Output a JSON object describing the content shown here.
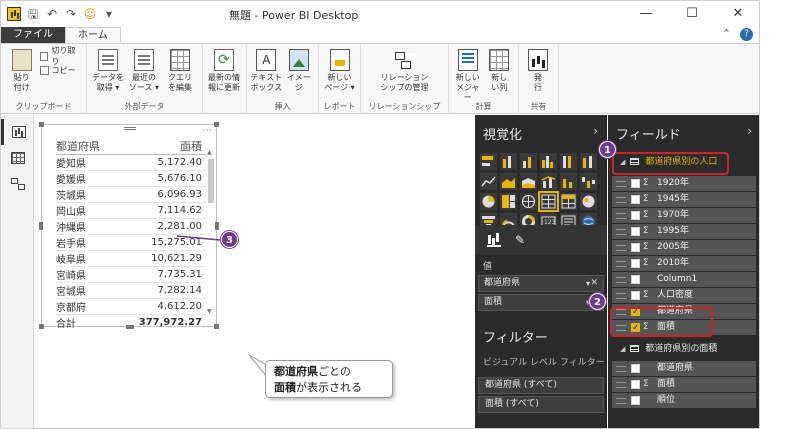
{
  "window": {
    "title": "無題 - Power BI Desktop",
    "controls": {
      "minimize": "—",
      "maximize": "☐",
      "close": "✕"
    }
  },
  "qat": {
    "save": "🖫",
    "undo": "↶",
    "redo": "↷",
    "smile": "☺",
    "more": "▾"
  },
  "tabs": [
    {
      "label": "ファイル"
    },
    {
      "label": "ホーム"
    }
  ],
  "help": "?",
  "collapse": "⌃",
  "ribbon": {
    "groups": [
      {
        "label": "クリップボード",
        "paste": "貼り\n付け",
        "cut": "切り取り",
        "copy": "コピー"
      },
      {
        "label": "外部データ",
        "buttons": [
          "データを\n取得 ▾",
          "最近の\nソース ▾",
          "クエリ\nを編集"
        ]
      },
      {
        "label": "",
        "buttons": [
          "最新の情\n報に更新"
        ]
      },
      {
        "label": "挿入",
        "buttons": [
          "テキスト\nボックス",
          "イメー\nジ"
        ]
      },
      {
        "label": "レポート",
        "buttons": [
          "新しい\nページ ▾"
        ]
      },
      {
        "label": "リレーションシップ",
        "buttons": [
          "リレーション\nシップの管理"
        ]
      },
      {
        "label": "計算",
        "buttons": [
          "新しい\nメジャー",
          "新し\nい列"
        ]
      },
      {
        "label": "共有",
        "buttons": [
          "発\n行"
        ]
      }
    ]
  },
  "table": {
    "headers": [
      "都道府県",
      "面積"
    ],
    "rows": [
      [
        "愛知県",
        "5,172.40"
      ],
      [
        "愛媛県",
        "5,676.10"
      ],
      [
        "茨城県",
        "6,096.93"
      ],
      [
        "岡山県",
        "7,114.62"
      ],
      [
        "沖縄県",
        "2,281.00"
      ],
      [
        "岩手県",
        "15,275.01"
      ],
      [
        "岐阜県",
        "10,621.29"
      ],
      [
        "宮崎県",
        "7,735.31"
      ],
      [
        "宮城県",
        "7,282.14"
      ],
      [
        "京都府",
        "4,612.20"
      ]
    ],
    "total": [
      "合計",
      "377,972.27"
    ],
    "more": "···"
  },
  "callout": {
    "badges": [
      "1",
      "2",
      "3"
    ],
    "line1_bold": "都道府県",
    "line1_rest": "ごとの",
    "line2_bold": "面積",
    "line2_rest": "が表示される"
  },
  "viz_pane": {
    "title": "視覚化",
    "chevron": "›",
    "values_label": "値",
    "wells": [
      "都道府県",
      "面積"
    ],
    "well_remove": "✕",
    "well_dropdown": "▾",
    "filter_title": "フィルター",
    "filter_sub": "ビジュアル レベル フィルター",
    "filters": [
      "都道府県 (すべて)",
      "面積 (すべて)"
    ],
    "brush_icon": "✎"
  },
  "fields_pane": {
    "title": "フィールド",
    "chevron": "›",
    "expanded_marker": "◢",
    "sigma": "Σ",
    "table1": "都道府県別の人口",
    "table1_fields": [
      {
        "name": "1920年",
        "sigma": true,
        "checked": false
      },
      {
        "name": "1945年",
        "sigma": true,
        "checked": false
      },
      {
        "name": "1970年",
        "sigma": true,
        "checked": false
      },
      {
        "name": "1995年",
        "sigma": true,
        "checked": false
      },
      {
        "name": "2005年",
        "sigma": true,
        "checked": false
      },
      {
        "name": "2010年",
        "sigma": true,
        "checked": false
      },
      {
        "name": "Column1",
        "sigma": false,
        "checked": false
      },
      {
        "name": "人口密度",
        "sigma": true,
        "checked": false
      },
      {
        "name": "都道府県",
        "sigma": false,
        "checked": true
      },
      {
        "name": "面積",
        "sigma": true,
        "checked": true
      }
    ],
    "table2": "都道府県別の面積",
    "table2_fields": [
      {
        "name": "都道府県",
        "sigma": false,
        "checked": false
      },
      {
        "name": "面積",
        "sigma": true,
        "checked": false
      },
      {
        "name": "順位",
        "sigma": false,
        "checked": false
      }
    ]
  },
  "colors": {
    "accent": "#e8b500",
    "badge": "#6d3a8c",
    "highlight": "#d0202a",
    "pane": "#2b2b2b"
  }
}
